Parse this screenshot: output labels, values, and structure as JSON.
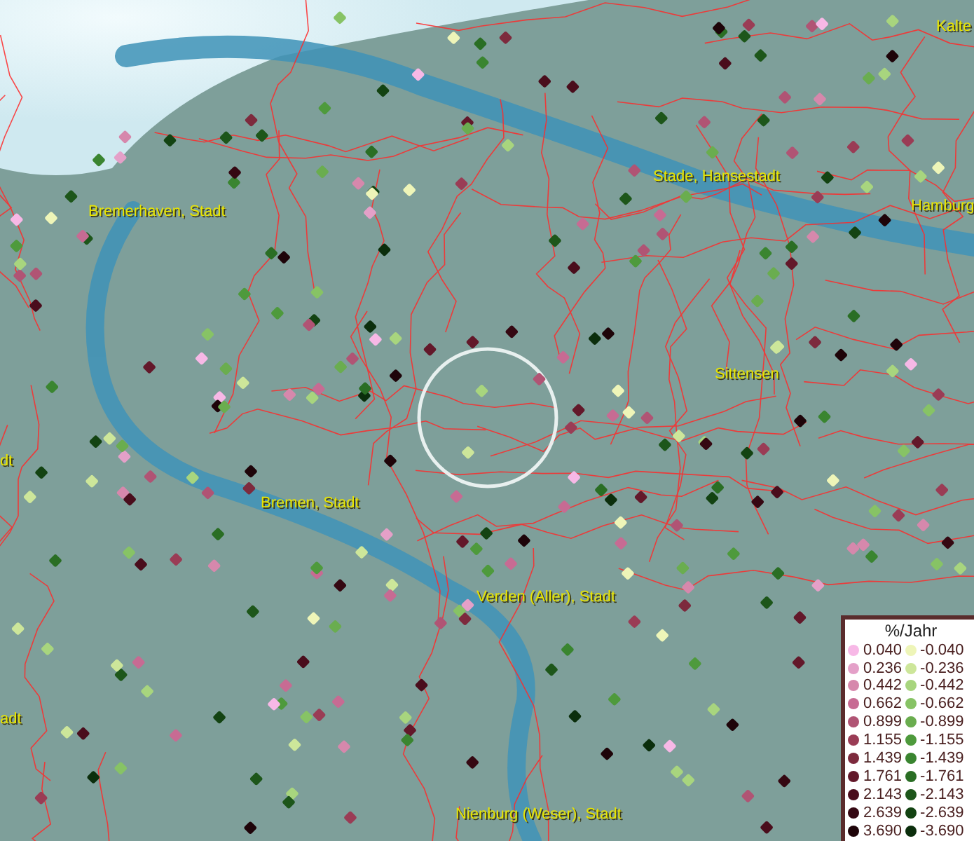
{
  "map": {
    "place_labels": [
      {
        "text": "Kalte"
      },
      {
        "text": "Stade, Hansestadt"
      },
      {
        "text": "Bremerhaven, Stadt"
      },
      {
        "text": "Hamburg"
      },
      {
        "text": "Sittensen"
      },
      {
        "text": "dt"
      },
      {
        "text": "Bremen, Stadt"
      },
      {
        "text": "Verden (Aller), Stadt"
      },
      {
        "text": "adt"
      },
      {
        "text": "Nienburg (Weser), Stadt"
      }
    ]
  },
  "legend": {
    "title": "%/Jahr",
    "positive": [
      {
        "value": "0.040",
        "color": "#f7b8e6"
      },
      {
        "value": "0.236",
        "color": "#e4a0c8"
      },
      {
        "value": "0.442",
        "color": "#d688ac"
      },
      {
        "value": "0.662",
        "color": "#c76b93"
      },
      {
        "value": "0.899",
        "color": "#b05474"
      },
      {
        "value": "1.155",
        "color": "#9a3c55"
      },
      {
        "value": "1.439",
        "color": "#7d2a3d"
      },
      {
        "value": "1.761",
        "color": "#63182a"
      },
      {
        "value": "2.143",
        "color": "#4a0d1c"
      },
      {
        "value": "2.639",
        "color": "#350812"
      },
      {
        "value": "3.690",
        "color": "#1e0409"
      }
    ],
    "negative": [
      {
        "value": "-0.040",
        "color": "#eef5b8"
      },
      {
        "value": "-0.236",
        "color": "#cde69a"
      },
      {
        "value": "-0.442",
        "color": "#a8d57e"
      },
      {
        "value": "-0.662",
        "color": "#87c365"
      },
      {
        "value": "-0.899",
        "color": "#6aad4f"
      },
      {
        "value": "-1.155",
        "color": "#4e9a3c"
      },
      {
        "value": "-1.439",
        "color": "#3a8530"
      },
      {
        "value": "-1.761",
        "color": "#2a6e24"
      },
      {
        "value": "-2.143",
        "color": "#1d561a"
      },
      {
        "value": "-2.639",
        "color": "#134312"
      },
      {
        "value": "-3.690",
        "color": "#0b2e0c"
      }
    ]
  }
}
